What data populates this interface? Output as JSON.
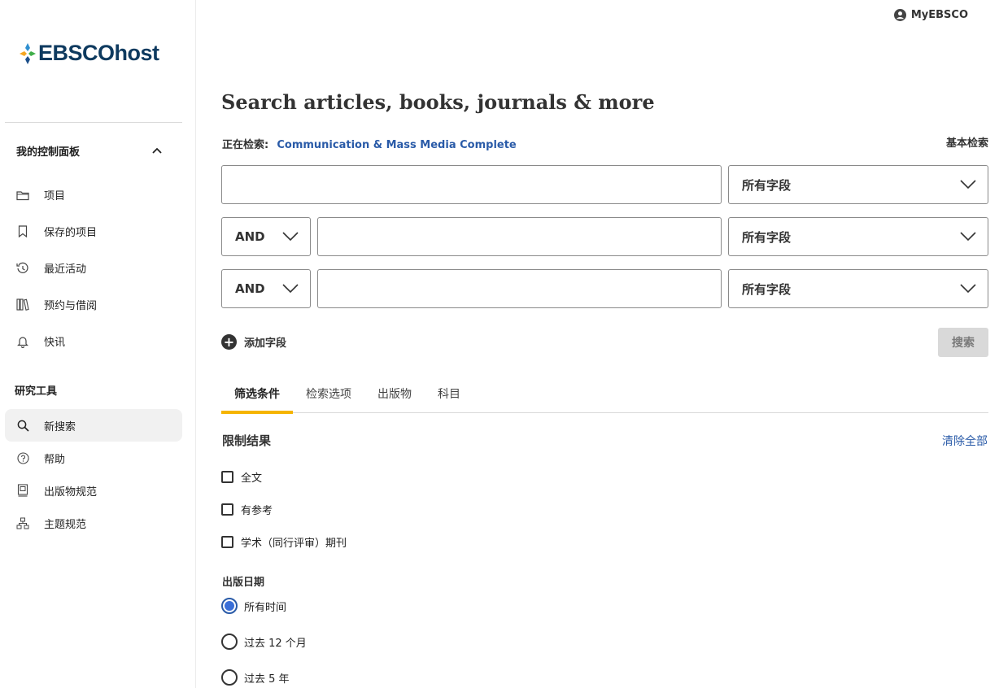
{
  "brand": {
    "name": "EBSCOhost",
    "accent": "#0e3a5f"
  },
  "header": {
    "account_label": "MyEBSCO"
  },
  "sidebar": {
    "dashboard_heading": "我的控制面板",
    "dashboard_items": [
      {
        "label": "项目",
        "icon": "folder-icon"
      },
      {
        "label": "保存的项目",
        "icon": "bookmark-icon"
      },
      {
        "label": "最近活动",
        "icon": "history-icon"
      },
      {
        "label": "预约与借阅",
        "icon": "books-icon"
      },
      {
        "label": "快讯",
        "icon": "bell-icon"
      }
    ],
    "tools_heading": "研究工具",
    "tools_items": [
      {
        "label": "新搜索",
        "icon": "search-icon",
        "active": true
      },
      {
        "label": "帮助",
        "icon": "help-icon"
      },
      {
        "label": "出版物规范",
        "icon": "publication-icon"
      },
      {
        "label": "主题规范",
        "icon": "hierarchy-icon"
      }
    ]
  },
  "main": {
    "title": "Search articles, books, journals & more",
    "searching_label": "正在检索:",
    "database": "Communication & Mass Media Complete",
    "basic_search_link": "基本检索",
    "rows": [
      {
        "operator": null,
        "term": "",
        "field": "所有字段"
      },
      {
        "operator": "AND",
        "term": "",
        "field": "所有字段"
      },
      {
        "operator": "AND",
        "term": "",
        "field": "所有字段"
      }
    ],
    "add_field_label": "添加字段",
    "search_button": "搜索",
    "tabs": [
      "筛选条件",
      "检索选项",
      "出版物",
      "科目"
    ],
    "active_tab": 0,
    "limit_title": "限制结果",
    "clear_all": "清除全部",
    "limiters": [
      "全文",
      "有参考",
      "学术（同行评审）期刊"
    ],
    "date_title": "出版日期",
    "date_options": [
      "所有时间",
      "过去 12 个月",
      "过去 5 年"
    ],
    "date_selected": 0
  }
}
